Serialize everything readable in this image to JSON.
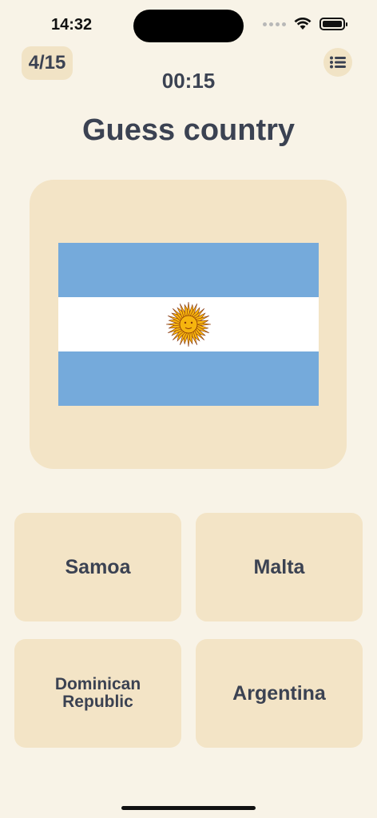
{
  "status_bar": {
    "time": "14:32"
  },
  "header": {
    "progress": "4/15",
    "timer": "00:15",
    "menu_icon": "list-icon"
  },
  "title": "Guess country",
  "flag": {
    "icon": "argentina-flag",
    "colors": {
      "blue": "#75aadb",
      "white": "#ffffff",
      "sun": "#f6b40e"
    }
  },
  "answers": [
    {
      "label": "Samoa"
    },
    {
      "label": "Malta"
    },
    {
      "label": "Dominican\nRepublic"
    },
    {
      "label": "Argentina"
    }
  ],
  "colors": {
    "background": "#f8f3e7",
    "card": "#f3e4c6",
    "text": "#3b4252"
  }
}
